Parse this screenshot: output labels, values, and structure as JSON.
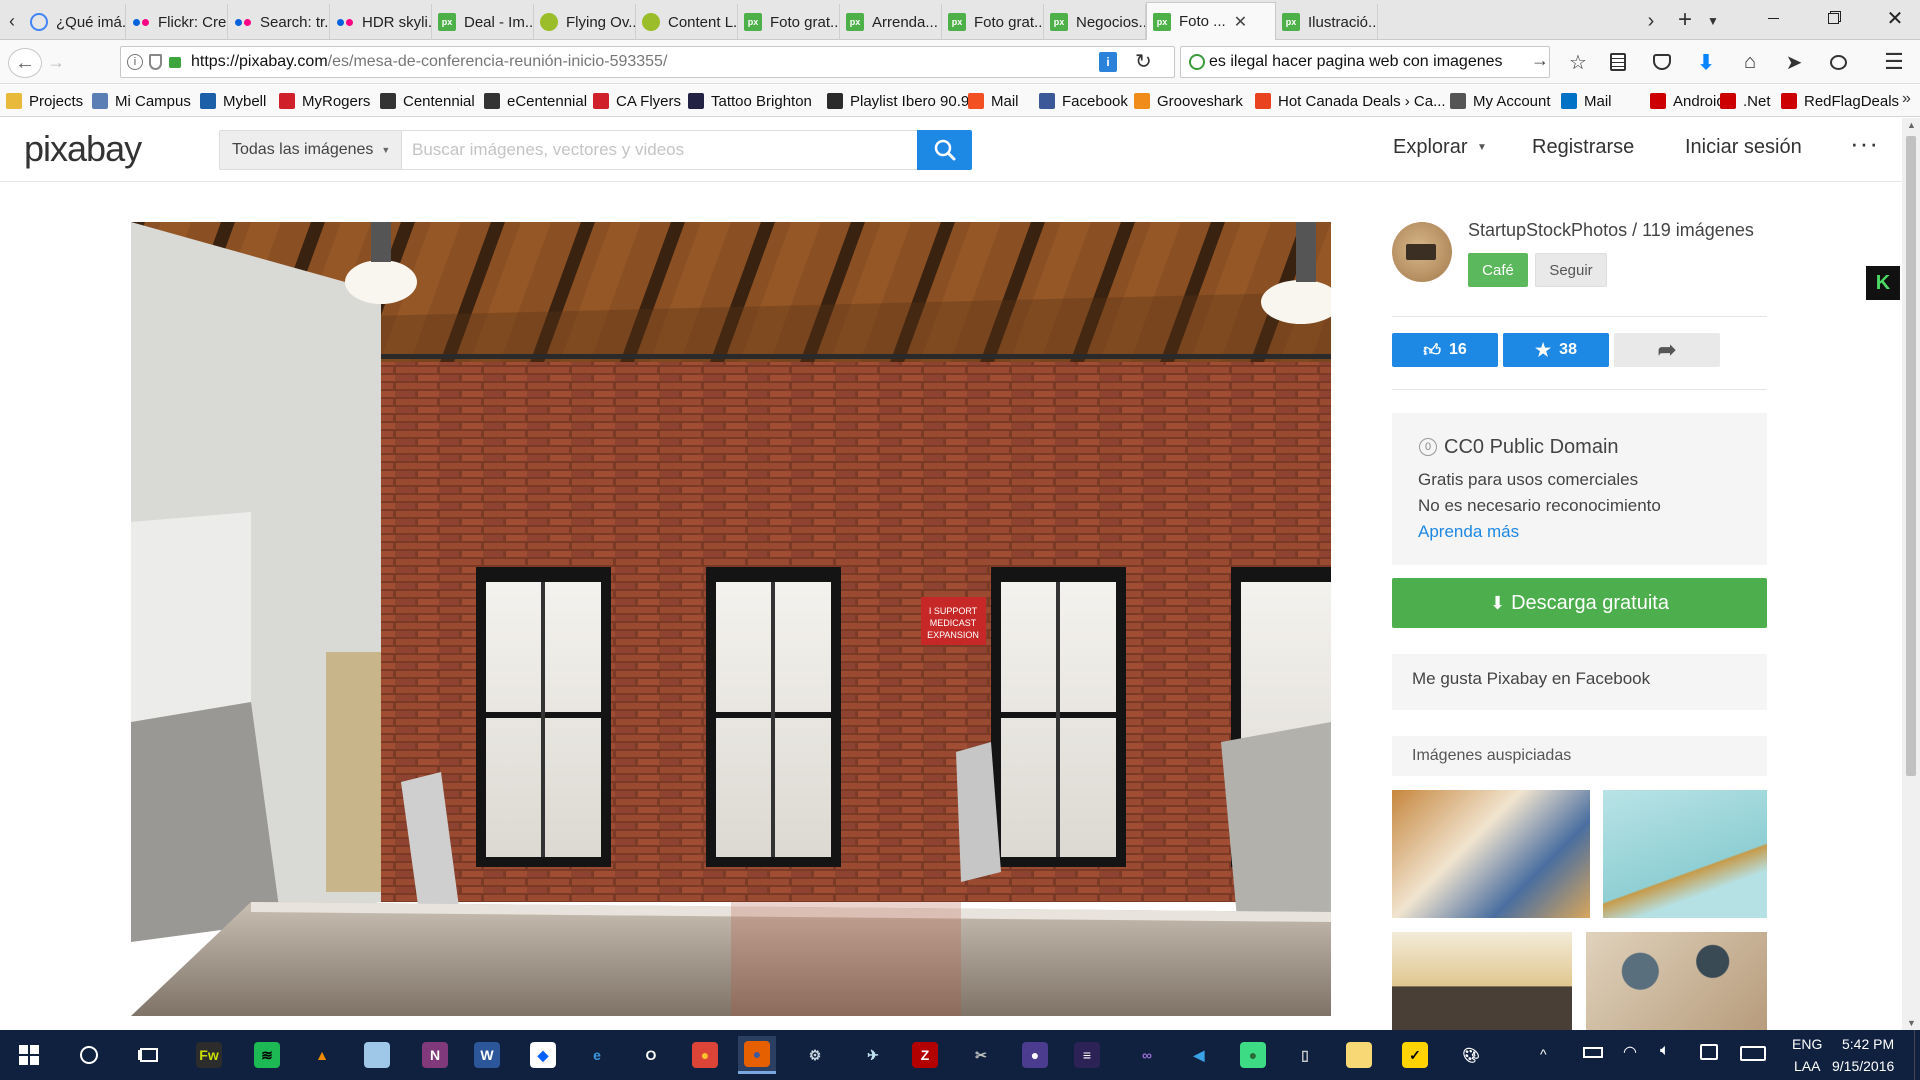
{
  "browser": {
    "tabs": [
      {
        "title": "¿Qué imá...",
        "icon": "google-icon"
      },
      {
        "title": "Flickr: Cre...",
        "icon": "flickr-icon"
      },
      {
        "title": "Search: tr...",
        "icon": "flickr-icon"
      },
      {
        "title": "HDR skyli...",
        "icon": "flickr-icon"
      },
      {
        "title": "Deal - Im...",
        "icon": "pixabay-icon"
      },
      {
        "title": "Flying Ov...",
        "icon": "flying-icon"
      },
      {
        "title": "Content L...",
        "icon": "flying-icon"
      },
      {
        "title": "Foto grat...",
        "icon": "pixabay-icon"
      },
      {
        "title": "Arrenda...",
        "icon": "pixabay-icon"
      },
      {
        "title": "Foto grat...",
        "icon": "pixabay-icon"
      },
      {
        "title": "Negocios...",
        "icon": "pixabay-icon"
      },
      {
        "title": "Foto ...",
        "icon": "pixabay-icon",
        "active": true
      },
      {
        "title": "Ilustració...",
        "icon": "pixabay-icon"
      }
    ],
    "url_prefix": "https://pixabay.com",
    "url_path": "/es/mesa-de-conferencia-reunión-inicio-593355/",
    "search_text": "es ilegal hacer pagina web con imagenes",
    "bookmarks": [
      {
        "label": "Projects",
        "color": "#e8b93a"
      },
      {
        "label": "Mi Campus",
        "color": "#5a7fb5"
      },
      {
        "label": "Mybell",
        "color": "#1b5fa8"
      },
      {
        "label": "MyRogers",
        "color": "#d0202a"
      },
      {
        "label": "Centennial",
        "color": "#333333"
      },
      {
        "label": "eCentennial",
        "color": "#333333"
      },
      {
        "label": "CA Flyers",
        "color": "#d0202a"
      },
      {
        "label": "Tattoo Brighton",
        "color": "#222244"
      },
      {
        "label": "Playlist Ibero 90.9",
        "color": "#2b2b2b"
      },
      {
        "label": "Mail",
        "color": "#f25022"
      },
      {
        "label": "Facebook",
        "color": "#3b5998"
      },
      {
        "label": "Grooveshark",
        "color": "#f08c1a"
      },
      {
        "label": "Hot Canada Deals › Ca...",
        "color": "#e8421e"
      },
      {
        "label": "My Account",
        "color": "#555555"
      },
      {
        "label": "Mail",
        "color": "#0072c6"
      },
      {
        "label": "Android",
        "color": "#cc0000"
      },
      {
        "label": ".Net",
        "color": "#cc0000"
      },
      {
        "label": "RedFlagDeals",
        "color": "#cc0000"
      }
    ]
  },
  "site": {
    "logo": "pixabay",
    "category_select": "Todas las imágenes",
    "search_placeholder": "Buscar imágenes, vectores y videos",
    "nav": {
      "explore": "Explorar",
      "register": "Registrarse",
      "login": "Iniciar sesión"
    }
  },
  "photo": {
    "sign_line1": "I SUPPORT",
    "sign_line2": "MEDICAST",
    "sign_line3": "EXPANSION"
  },
  "sidebar": {
    "author": "StartupStockPhotos / 119 imágenes",
    "coffee_button": "Café",
    "follow_button": "Seguir",
    "likes": "16",
    "favorites": "38",
    "license_title": "CC0 Public Domain",
    "license_line1": "Gratis para usos comerciales",
    "license_line2": "No es necesario reconocimiento",
    "learn_more": "Aprenda más",
    "download": "Descarga gratuita",
    "facebook": "Me gusta Pixabay en Facebook",
    "sponsored": "Imágenes auspiciadas"
  },
  "taskbar": {
    "language": "ENG",
    "layout": "LAA",
    "time": "5:42 PM",
    "date": "9/15/2016"
  },
  "colors": {
    "accent_blue": "#1e88e5",
    "download_green": "#4cae4c",
    "coffee_green": "#5cb85c",
    "taskbar": "#10213f"
  }
}
